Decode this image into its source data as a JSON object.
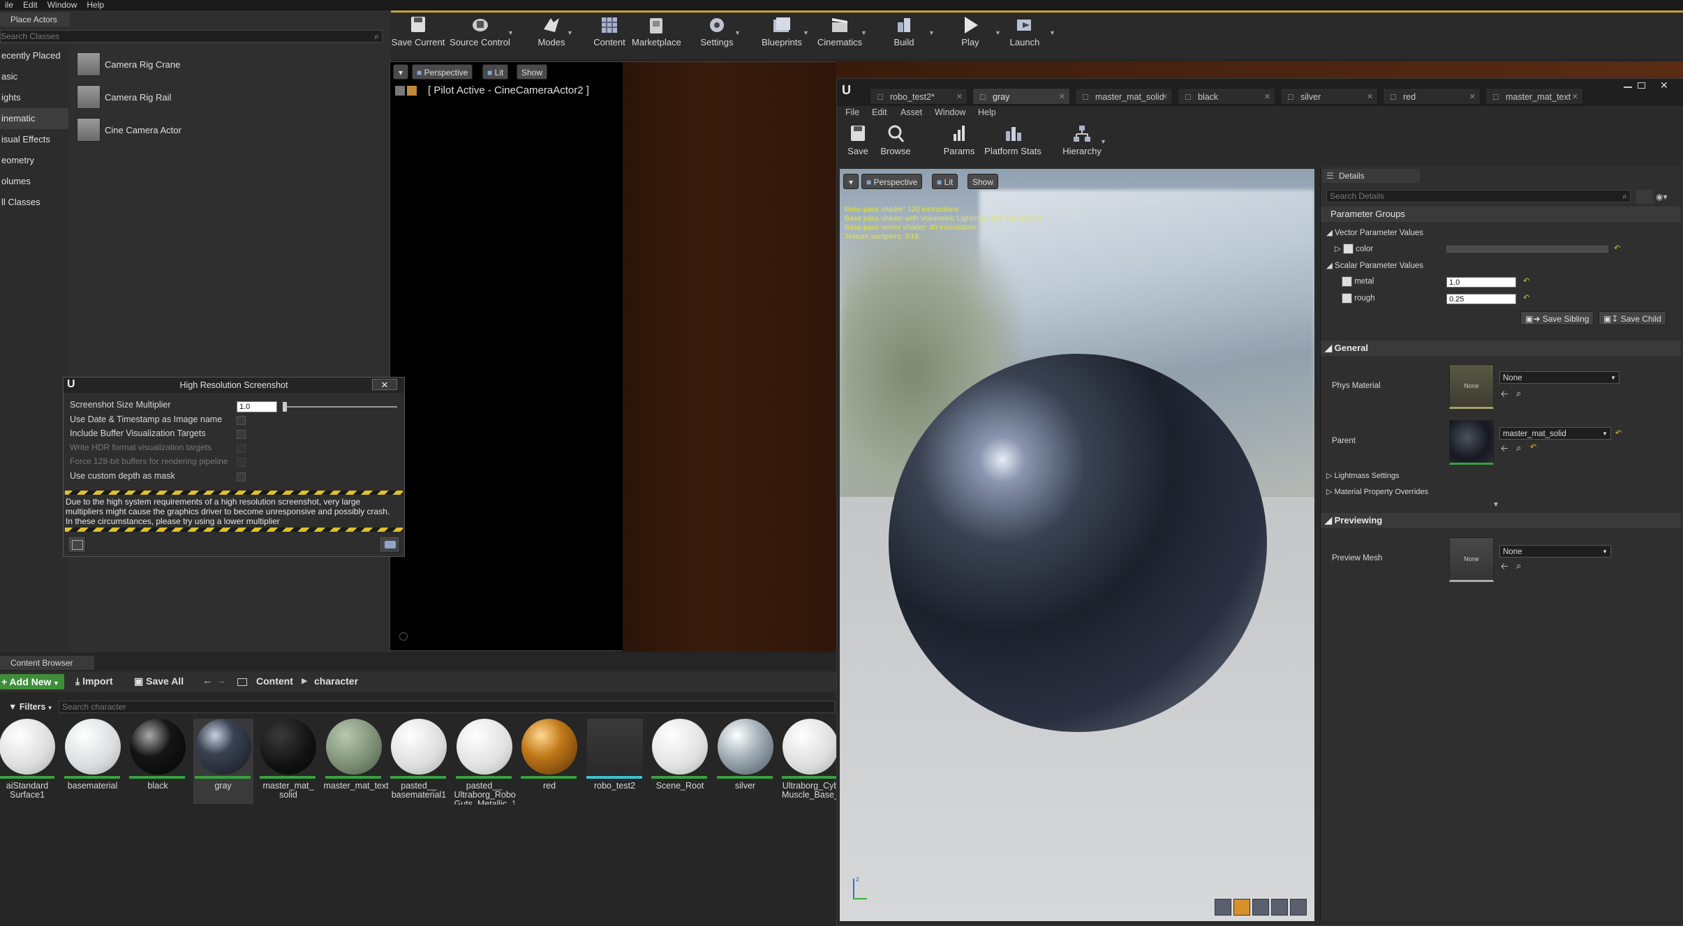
{
  "menubar": [
    "ile",
    "Edit",
    "Window",
    "Help"
  ],
  "place_actors": {
    "tab": "Place Actors",
    "search_placeholder": "Search Classes",
    "categories": [
      "ecently Placed",
      "asic",
      "ights",
      "inematic",
      "isual Effects",
      "eometry",
      "olumes",
      "ll Classes"
    ],
    "items": [
      "Camera Rig Crane",
      "Camera Rig Rail",
      "Cine Camera Actor"
    ]
  },
  "toolbar": {
    "buttons": [
      "Save Current",
      "Source Control",
      "Modes",
      "Content",
      "Marketplace",
      "Settings",
      "Blueprints",
      "Cinematics",
      "Build",
      "Play",
      "Launch"
    ]
  },
  "viewport": {
    "perspective": "Perspective",
    "lit": "Lit",
    "show": "Show",
    "pilot": "[ Pilot Active - CineCameraActor2 ]"
  },
  "screenshot_dialog": {
    "title": "High Resolution Screenshot",
    "rows": [
      "Screenshot Size Multiplier",
      "Use Date & Timestamp as Image name",
      "Include Buffer Visualization Targets",
      "Write HDR format visualization targets",
      "Force 128-bit buffers for rendering pipeline",
      "Use custom depth as mask"
    ],
    "multiplier": "1.0",
    "warning": [
      "Due to the high system requirements of a high resolution screenshot, very large",
      "multipliers might cause the graphics driver to become unresponsive and possibly crash.",
      "In these circumstances, please try using a lower multiplier"
    ]
  },
  "content_browser": {
    "tab": "Content Browser",
    "add_new": "Add New",
    "import": "Import",
    "save_all": "Save All",
    "path_root": "Content",
    "path_folder": "character",
    "filters": "Filters",
    "search_placeholder": "Search character",
    "assets": [
      {
        "line1": "aiStandard",
        "line2": "Surface1"
      },
      {
        "line1": "basematerial",
        "line2": ""
      },
      {
        "line1": "black",
        "line2": ""
      },
      {
        "line1": "gray",
        "line2": ""
      },
      {
        "line1": "master_mat_",
        "line2": "solid"
      },
      {
        "line1": "master_mat_text",
        "line2": ""
      },
      {
        "line1": "pasted__",
        "line2": "basematerial1"
      },
      {
        "line1": "pasted__",
        "line2": "Ultraborg_Robo"
      },
      {
        "line1": "red",
        "line2": ""
      },
      {
        "line1": "robo_test2",
        "line2": ""
      },
      {
        "line1": "Scene_Root",
        "line2": ""
      },
      {
        "line1": "silver",
        "line2": ""
      },
      {
        "line1": "Ultraborg_Cyb",
        "line2": "Muscle_Base_"
      }
    ],
    "assets_extra": "Guts_Metallic_1"
  },
  "material_editor": {
    "tabs": [
      "robo_test2*",
      "gray",
      "master_mat_solid",
      "black",
      "silver",
      "red",
      "master_mat_text"
    ],
    "menu": [
      "File",
      "Edit",
      "Asset",
      "Window",
      "Help"
    ],
    "toolbar": [
      "Save",
      "Browse",
      "Params",
      "Platform Stats",
      "Hierarchy"
    ],
    "stats": [
      "Base pass shader: 120 instructions",
      "Base pass shader with Volumetric Lightmap: 134 instructions",
      "Base pass vertex shader: 40 instructions",
      "Texture samplers: 3/16"
    ],
    "details": {
      "tab": "Details",
      "search_placeholder": "Search Details",
      "parameter_groups": "Parameter Groups",
      "vector_values": "Vector Parameter Values",
      "color": "color",
      "scalar_values": "Scalar Parameter Values",
      "metal": "metal",
      "metal_value": "1.0",
      "rough": "rough",
      "rough_value": "0.25",
      "save_sibling": "Save Sibling",
      "save_child": "Save Child",
      "general": "General",
      "phys_material": "Phys Material",
      "phys_none": "None",
      "phys_thumb": "None",
      "parent": "Parent",
      "parent_value": "master_mat_solid",
      "lightmass": "Lightmass Settings",
      "overrides": "Material Property Overrides",
      "previewing": "Previewing",
      "preview_mesh": "Preview Mesh",
      "preview_none": "None",
      "preview_thumb": "None"
    }
  }
}
